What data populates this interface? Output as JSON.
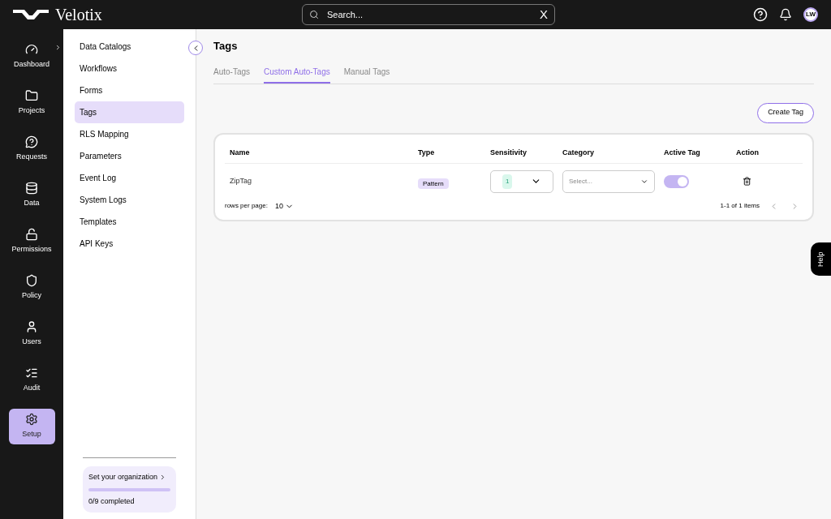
{
  "brand": "Velotix",
  "search": {
    "placeholder": "Search...",
    "clear": "X"
  },
  "user": {
    "initials": "LW"
  },
  "nav": [
    {
      "label": "Dashboard",
      "selected": false,
      "expandable": true
    },
    {
      "label": "Projects",
      "selected": false,
      "expandable": false
    },
    {
      "label": "Requests",
      "selected": false,
      "expandable": false
    },
    {
      "label": "Data",
      "selected": false,
      "expandable": false
    },
    {
      "label": "Permissions",
      "selected": false,
      "expandable": false
    },
    {
      "label": "Policy",
      "selected": false,
      "expandable": false
    },
    {
      "label": "Users",
      "selected": false,
      "expandable": false
    },
    {
      "label": "Audit",
      "selected": false,
      "expandable": false
    },
    {
      "label": "Setup",
      "selected": true,
      "expandable": false
    }
  ],
  "submenu": [
    {
      "label": "Data Catalogs",
      "selected": false
    },
    {
      "label": "Workflows",
      "selected": false
    },
    {
      "label": "Forms",
      "selected": false
    },
    {
      "label": "Tags",
      "selected": true
    },
    {
      "label": "RLS Mapping",
      "selected": false
    },
    {
      "label": "Parameters",
      "selected": false
    },
    {
      "label": "Event Log",
      "selected": false
    },
    {
      "label": "System Logs",
      "selected": false
    },
    {
      "label": "Templates",
      "selected": false
    },
    {
      "label": "API Keys",
      "selected": false
    }
  ],
  "onboarding": {
    "title": "Set your organization",
    "progress": "0/9 completed"
  },
  "page": {
    "title": "Tags"
  },
  "tabs": [
    {
      "label": "Auto-Tags",
      "selected": false
    },
    {
      "label": "Custom Auto-Tags",
      "selected": true
    },
    {
      "label": "Manual Tags",
      "selected": false
    }
  ],
  "create_button": "Create Tag",
  "table": {
    "columns": [
      "Name",
      "Type",
      "Sensitivity",
      "Category",
      "Active Tag",
      "Action"
    ],
    "rows": [
      {
        "name": "ZipTag",
        "type": "Pattern",
        "sensitivity": "1",
        "category_placeholder": "Select...",
        "active": true
      }
    ]
  },
  "pagination": {
    "rows_label": "rows per page:",
    "rows_value": "10",
    "summary": "1-1 of 1 items"
  },
  "help": "Help"
}
